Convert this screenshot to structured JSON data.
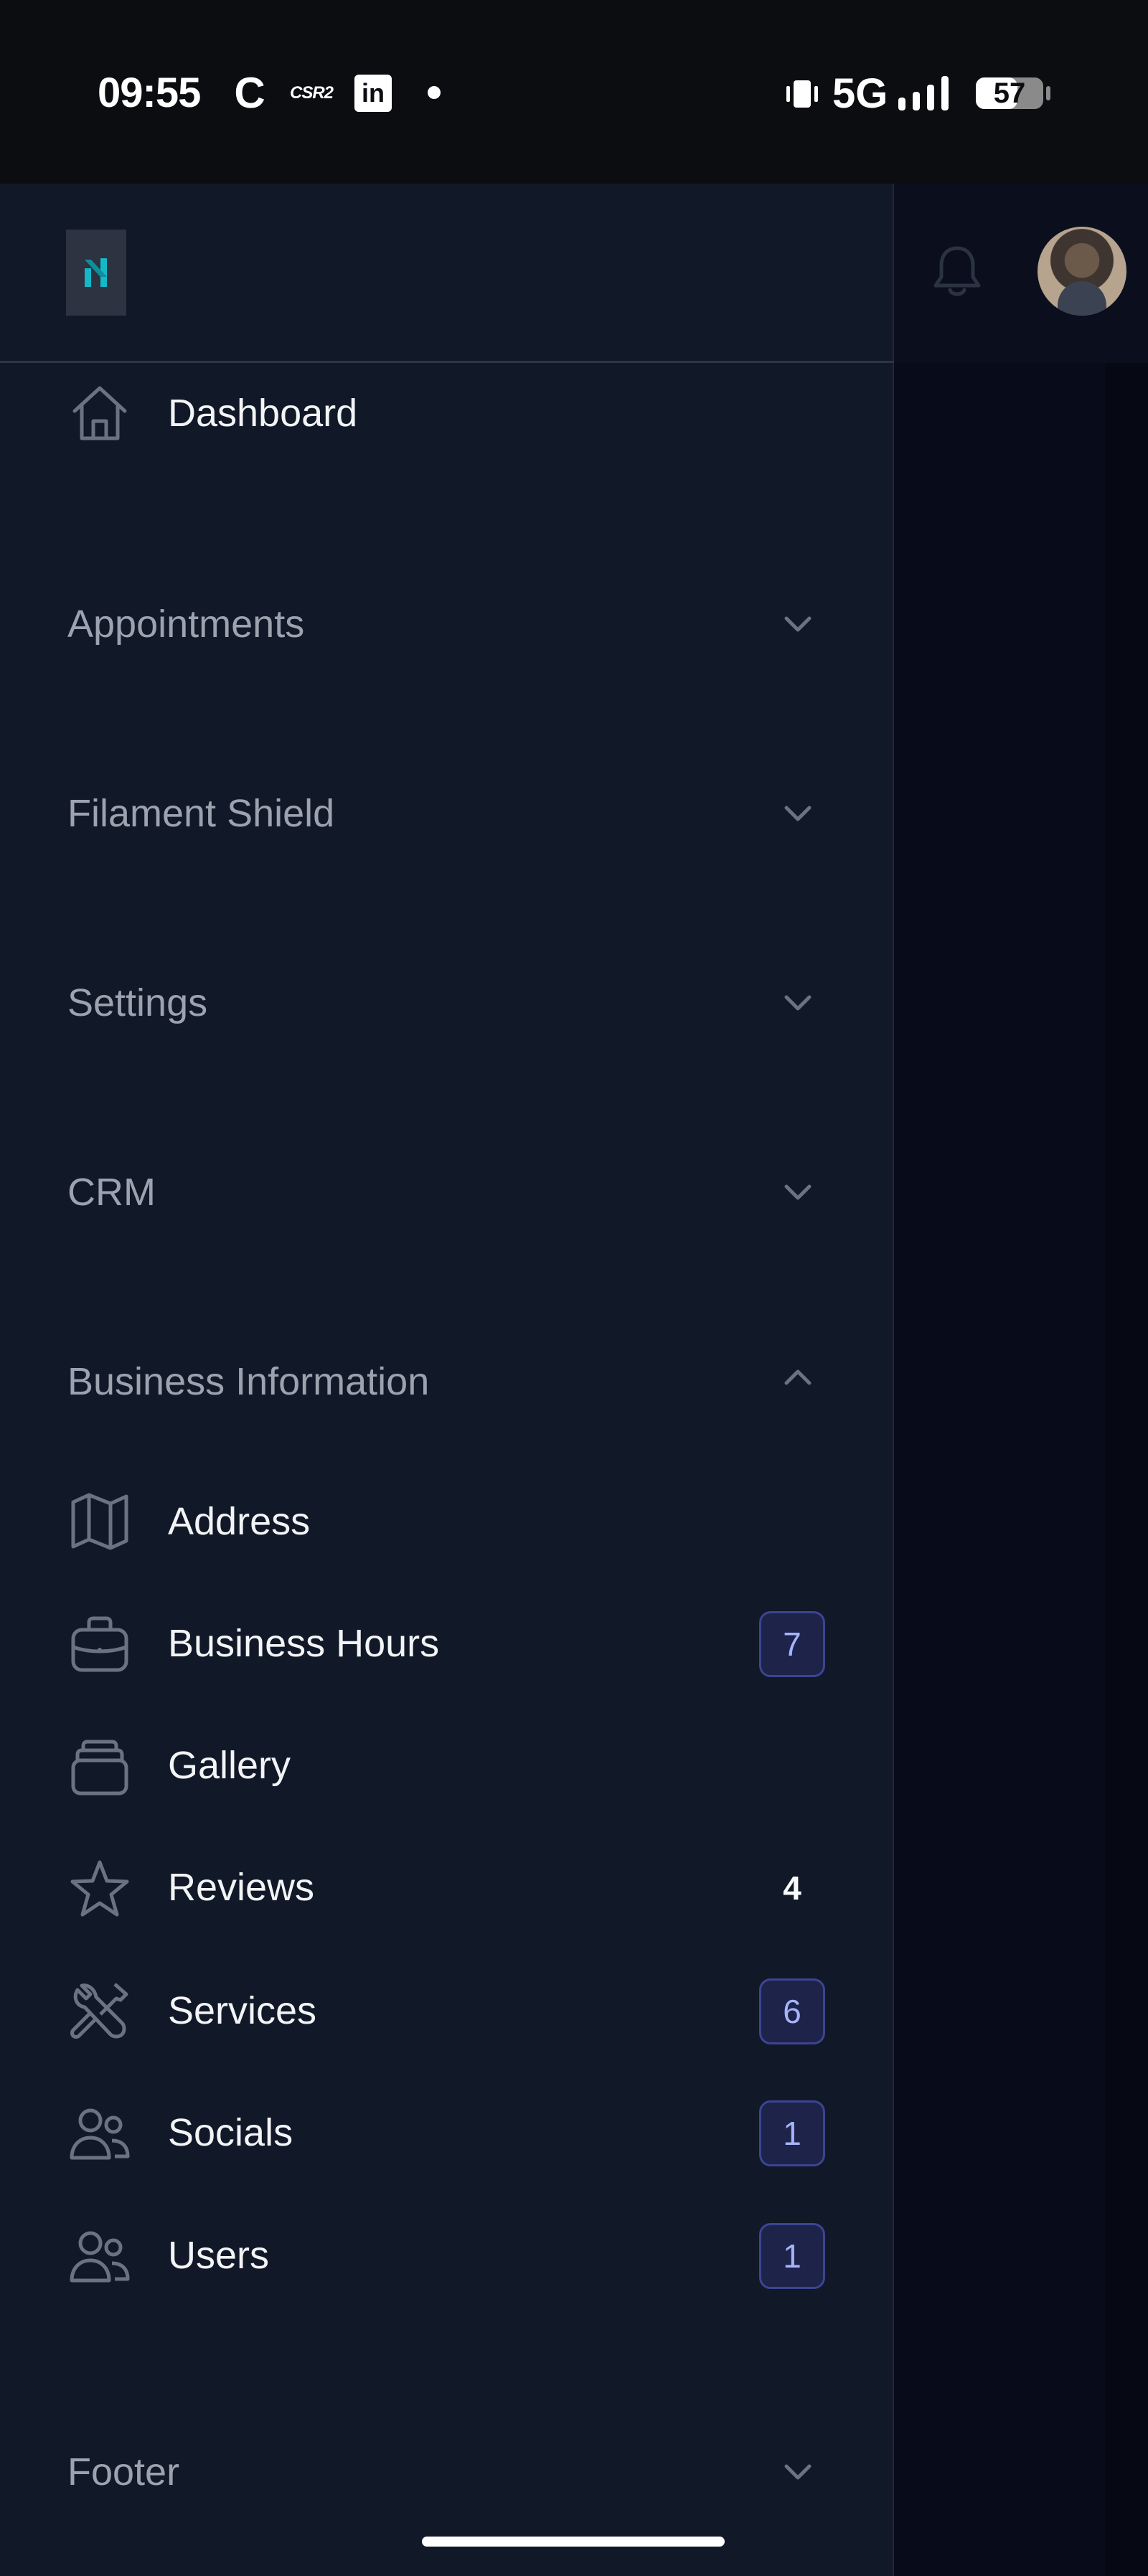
{
  "status_bar": {
    "time": "09:55",
    "app_icons": [
      "C",
      "CSR2",
      "in"
    ],
    "network": "5G",
    "battery": "57"
  },
  "header": {
    "logo_icon": "app-logo-icon",
    "notification_icon": "bell-icon",
    "avatar_icon": "user-avatar"
  },
  "nav": {
    "dashboard": "Dashboard",
    "groups": {
      "appointments": "Appointments",
      "filament_shield": "Filament Shield",
      "settings": "Settings",
      "crm": "CRM",
      "business_information": "Business Information",
      "footer": "Footer"
    },
    "business_items": [
      {
        "label": "Address",
        "icon": "map-icon",
        "badge": ""
      },
      {
        "label": "Business Hours",
        "icon": "briefcase-icon",
        "badge": "7"
      },
      {
        "label": "Gallery",
        "icon": "stack-icon",
        "badge": ""
      },
      {
        "label": "Reviews",
        "icon": "star-icon",
        "badge": "4"
      },
      {
        "label": "Services",
        "icon": "wrench-screwdriver-icon",
        "badge": "6"
      },
      {
        "label": "Socials",
        "icon": "users-icon",
        "badge": "1"
      },
      {
        "label": "Users",
        "icon": "users-icon",
        "badge": "1"
      }
    ]
  },
  "colors": {
    "sidebar_bg": "#111827",
    "badge_bg": "#1e2349",
    "badge_text": "#a5b4fc",
    "accent_logo": "#14b8c6"
  }
}
